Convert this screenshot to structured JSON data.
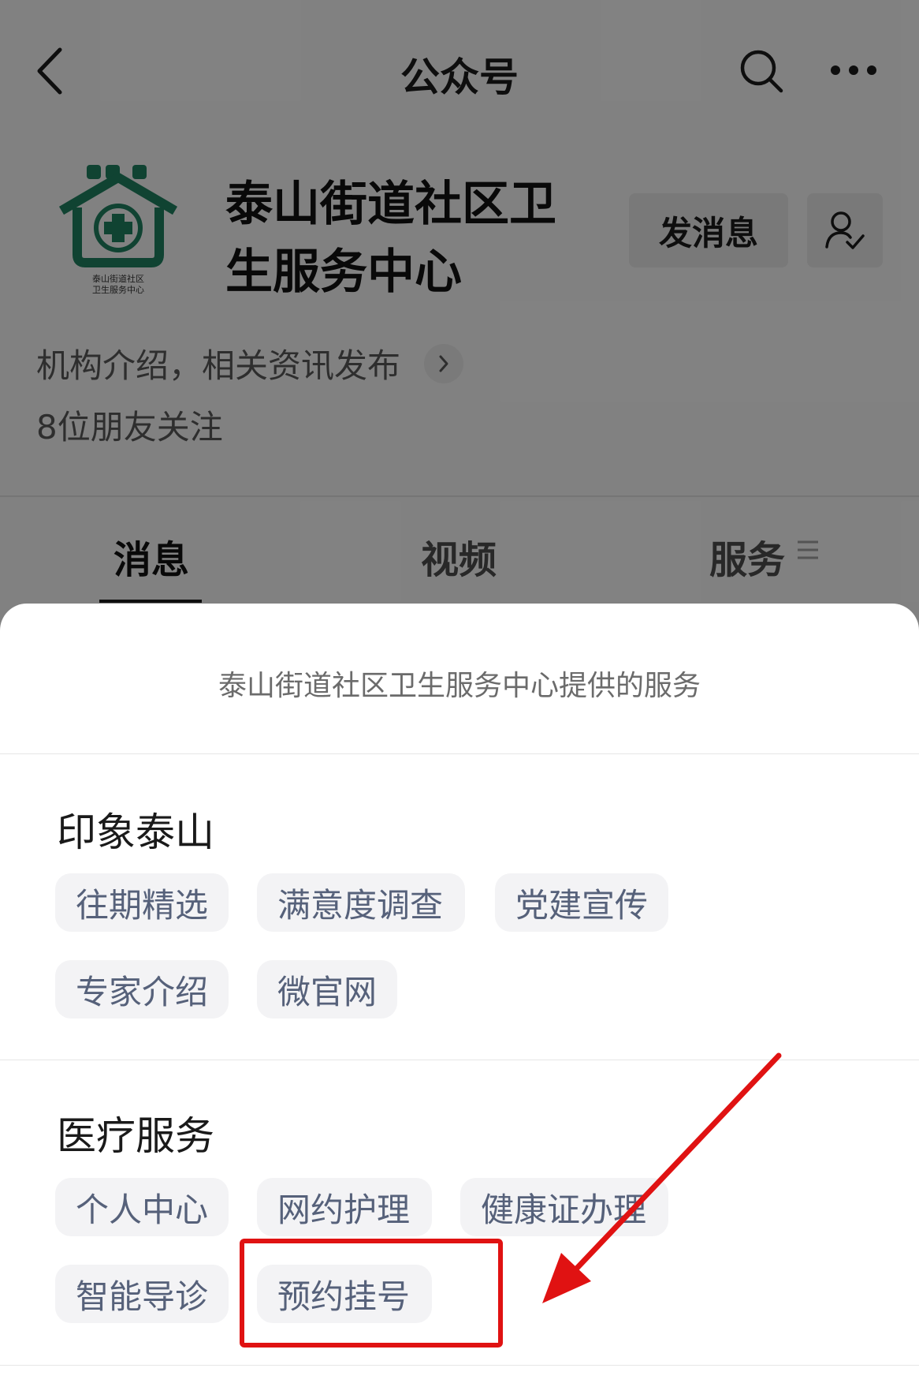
{
  "nav": {
    "title": "公众号"
  },
  "profile": {
    "name": "泰山街道社区卫生服务中心",
    "logo_text_line1": "泰山街道社区",
    "logo_text_line2": "卫生服务中心",
    "send_message_label": "发消息",
    "description": "机构介绍，相关资讯发布",
    "followers": "8位朋友关注"
  },
  "tabs": [
    {
      "label": "消息"
    },
    {
      "label": "视频"
    },
    {
      "label": "服务"
    }
  ],
  "sheet": {
    "title": "泰山街道社区卫生服务中心提供的服务",
    "sections": [
      {
        "title": "印象泰山",
        "items": [
          "往期精选",
          "满意度调查",
          "党建宣传",
          "专家介绍",
          "微官网"
        ]
      },
      {
        "title": "医疗服务",
        "items": [
          "个人中心",
          "网约护理",
          "健康证办理",
          "智能导诊",
          "预约挂号"
        ]
      }
    ]
  },
  "colors": {
    "brand_green": "#1e7a5c",
    "annotation_red": "#e01212",
    "chip_text": "#56617a"
  }
}
